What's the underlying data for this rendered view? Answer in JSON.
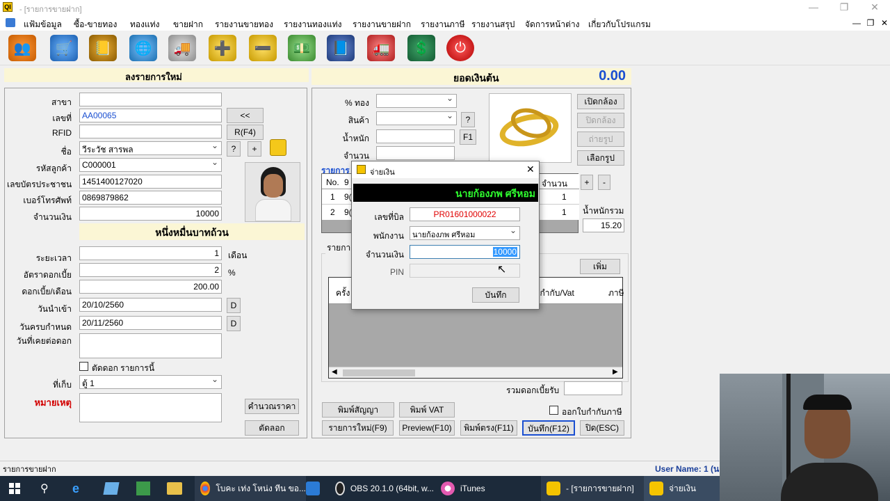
{
  "window": {
    "title": "- [รายการขายฝาก]",
    "app_icon": "QI",
    "controls": [
      "—",
      "❐",
      "✕"
    ]
  },
  "menu": [
    "แฟ้มข้อมูล",
    "ซื้อ-ขายทอง",
    "ทองแท่ง",
    "ขายฝาก",
    "รายงานขายทอง",
    "รายงานทองแท่ง",
    "รายงานขายฝาก",
    "รายงานภาษี",
    "รายงานสรุป",
    "จัดการหน้าต่าง",
    "เกี่ยวกับโปรแกรม"
  ],
  "mdi_controls": [
    "—",
    "❐",
    "✕"
  ],
  "toolbar_icons": [
    "users-icon",
    "gold-search-icon",
    "gold-book-icon",
    "gold-globe-icon",
    "gold-truck-icon",
    "gold-add-icon",
    "gold-remove-icon",
    "money-icon",
    "notebook-icon",
    "delivery-truck-icon",
    "ledger-icon",
    "power-icon"
  ],
  "header": {
    "new_entry_title": "ลงรายการใหม่",
    "balance_label": "ยอดเงินต้น",
    "balance_value": "0.00"
  },
  "left_form": {
    "branch_label": "สาขา",
    "branch_value": "",
    "number_label": "เลขที่",
    "number_value": "AA00065",
    "prev_button": "<<",
    "rfid_label": "RFID",
    "rfid_value": "",
    "rfid_button": "R(F4)",
    "name_label": "ชื่อ",
    "name_value": "วีระวัช สารพล",
    "help_button": "?",
    "add_button": "+",
    "customer_code_label": "รหัสลูกค้า",
    "customer_code_value": "C000001",
    "id_card_label": "เลขบัตรประชาชน",
    "id_card_value": "1451400127020",
    "phone_label": "เบอร์โทรศัพท์",
    "phone_value": "0869879862",
    "amount_label": "จำนวนเงิน",
    "amount_value": "10000",
    "amount_text": "หนึ่งหมื่นบาทถ้วน",
    "period_label": "ระยะเวลา",
    "period_value": "1",
    "period_unit": "เดือน",
    "interest_rate_label": "อัตราดอกเบี้ย",
    "interest_rate_value": "2",
    "interest_rate_unit": "%",
    "interest_month_label": "ดอกเบี้ย/เดือน",
    "interest_month_value": "200.00",
    "date_in_label": "วันนำเข้า",
    "date_in_value": "20/10/2560",
    "date_in_button": "D",
    "due_date_label": "วันครบกำหนด",
    "due_date_value": "20/11/2560",
    "due_date_button": "D",
    "paid_dates_label": "วันที่เคยต่อดอก",
    "cut_interest_label": "ตัดดอก รายการนี้",
    "storage_label": "ที่เก็บ",
    "storage_value": "ตู้ 1",
    "remark_label": "หมายเหตุ",
    "calc_button": "คำนวณราคา",
    "cut_button": "ตัดลอก"
  },
  "right_form": {
    "gold_percent_label": "% ทอง",
    "product_label": "สินค้า",
    "product_help": "?",
    "weight_label": "น้ำหนัก",
    "weight_button": "F1",
    "qty_label": "จำนวน",
    "open_camera": "เปิดกล้อง",
    "close_camera": "ปิดกล้อง",
    "take_photo": "ถ่ายรูป",
    "choose_photo": "เลือกรูป",
    "items_title": "รายการ",
    "table_headers": [
      "No.",
      "9",
      "จำนวน"
    ],
    "rows": [
      {
        "no": "1",
        "code": "9(",
        "qty": "1"
      },
      {
        "no": "2",
        "code": "9(",
        "qty": "1"
      }
    ],
    "plus": "+",
    "minus": "-",
    "total_weight_label": "น้ำหนักรวม",
    "total_weight_value": "15.20",
    "history_title": "รายการ",
    "add_button": "เพิ่ม",
    "history_headers": [
      "ครั้ง",
      "ใบกำกับ/Vat",
      "ภาษี"
    ],
    "sum_interest_label": "รวมดอกเบี้ยรับ",
    "print_contract": "พิมพ์สัญญา",
    "print_vat": "พิมพ์ VAT",
    "tax_invoice_label": "ออกใบกำกับภาษี",
    "new_item": "รายการใหม่(F9)",
    "preview": "Preview(F10)",
    "print_direct": "พิมพ์ตรง(F11)",
    "save": "บันทึก(F12)",
    "close": "ปิด(ESC)"
  },
  "dialog": {
    "title": "จ่ายเงิน",
    "employee_banner": "นายก้องภพ ศรีหอม",
    "bill_label": "เลขที่บิล",
    "bill_value": "PR01601000022",
    "employee_label": "พนักงาน",
    "employee_value": "นายก้องภพ ศรีหอม",
    "amount_label": "จำนวนเงิน",
    "amount_value": "10000",
    "pin_label": "PIN",
    "save_button": "บันทึก"
  },
  "status": {
    "left": "รายการขายฝาก",
    "user": "User Name: 1 (นา"
  },
  "taskbar": {
    "items": [
      "โบคะ เท่ง โหน่ง ทีน ขอ...",
      "OBS 20.1.0 (64bit, w...",
      "iTunes",
      "- [รายการขายฝาก]",
      "จ่ายเงิน"
    ]
  },
  "colors": {
    "accent_blue": "#1a4fd1",
    "remark_red": "#d20000",
    "banner_green": "#2fff2f",
    "bill_red": "#e00000"
  }
}
